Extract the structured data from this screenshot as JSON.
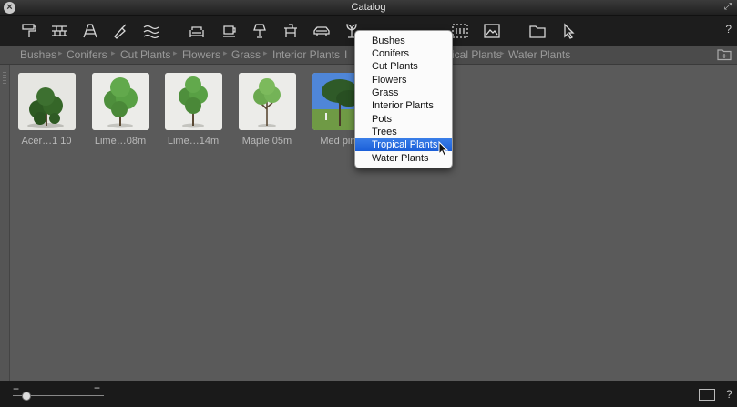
{
  "window": {
    "title": "Catalog",
    "help": "?"
  },
  "toolbar": {
    "icons": [
      "paint-roller-icon",
      "brick-wall-icon",
      "roof-icon",
      "trowel-icon",
      "water-waves-icon",
      "sofa-icon",
      "cup-icon",
      "lamp-icon",
      "table-icon",
      "car-icon",
      "plant-icon",
      "people-icon",
      "picture-frame-icon",
      "gallery-icon",
      "image-icon",
      "folder-icon",
      "pointer-icon"
    ],
    "help": "?"
  },
  "breadcrumbs": {
    "items": [
      "Bushes",
      "Conifers",
      "Cut Plants",
      "Flowers",
      "Grass",
      "Interior Plants",
      "Tropical Plants",
      "Water Plants"
    ],
    "partial_fragment": "I",
    "partial_fragment2": "ical Plants"
  },
  "thumbnails": [
    {
      "label": "Acer…1 10"
    },
    {
      "label": "Lime…08m"
    },
    {
      "label": "Lime…14m"
    },
    {
      "label": "Maple 05m"
    },
    {
      "label": "Med pine"
    }
  ],
  "dropdown": {
    "items": [
      "Bushes",
      "Conifers",
      "Cut Plants",
      "Flowers",
      "Grass",
      "Interior Plants",
      "Pots",
      "Trees",
      "Tropical Plants",
      "Water Plants"
    ],
    "selected": "Tropical Plants"
  },
  "zoom": {
    "minus": "−",
    "plus": "+",
    "level": 0.1
  },
  "bottombar": {
    "help": "?"
  },
  "colors": {
    "selection": "#1a5ed8",
    "background": "#5a5a5a",
    "toolbar": "#1d1d1d"
  }
}
